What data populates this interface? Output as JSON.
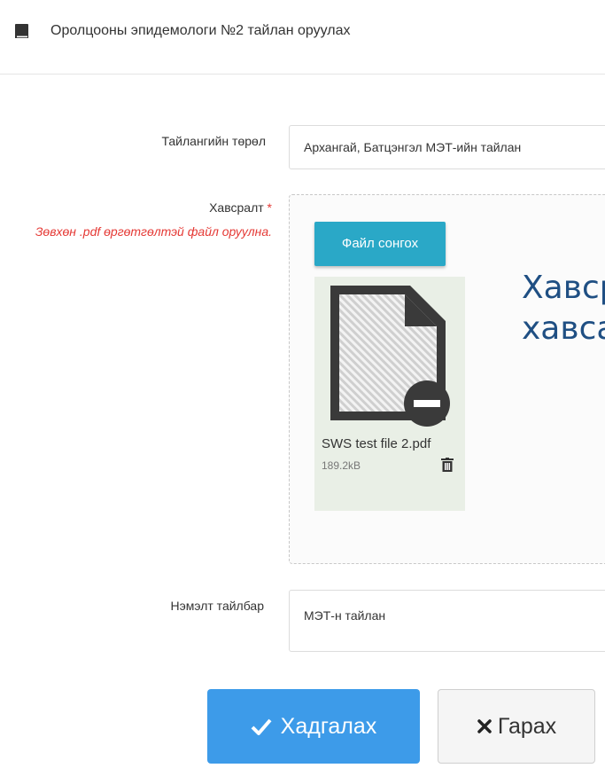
{
  "header": {
    "title": "Оролцооны эпидемологи №2 тайлан оруулах",
    "icon": "book-icon"
  },
  "form": {
    "report_type": {
      "label": "Тайлангийн төрөл",
      "value": "Архангай, Батцэнгэл МЭТ-ийн тайлан"
    },
    "attachment": {
      "label": "Хавсралт",
      "required_mark": "*",
      "hint": "Зөвхөн .pdf өргөтгөлтэй файл оруулна.",
      "choose_button": "Файл сонгох",
      "dropzone_message_line1": "Хавсралт",
      "dropzone_message_line2": "хавсаргах",
      "file": {
        "name": "SWS test file 2.pdf",
        "size": "189.2kB"
      }
    },
    "note": {
      "label": "Нэмэлт тайлбар",
      "value": "МЭТ-н тайлан"
    }
  },
  "actions": {
    "save_label": "Хадгалах",
    "exit_label": "Гарах"
  },
  "colors": {
    "primary": "#3d9be9",
    "info": "#2aa8c7",
    "danger": "#e53935",
    "dropzone_text": "#1f4f83"
  }
}
